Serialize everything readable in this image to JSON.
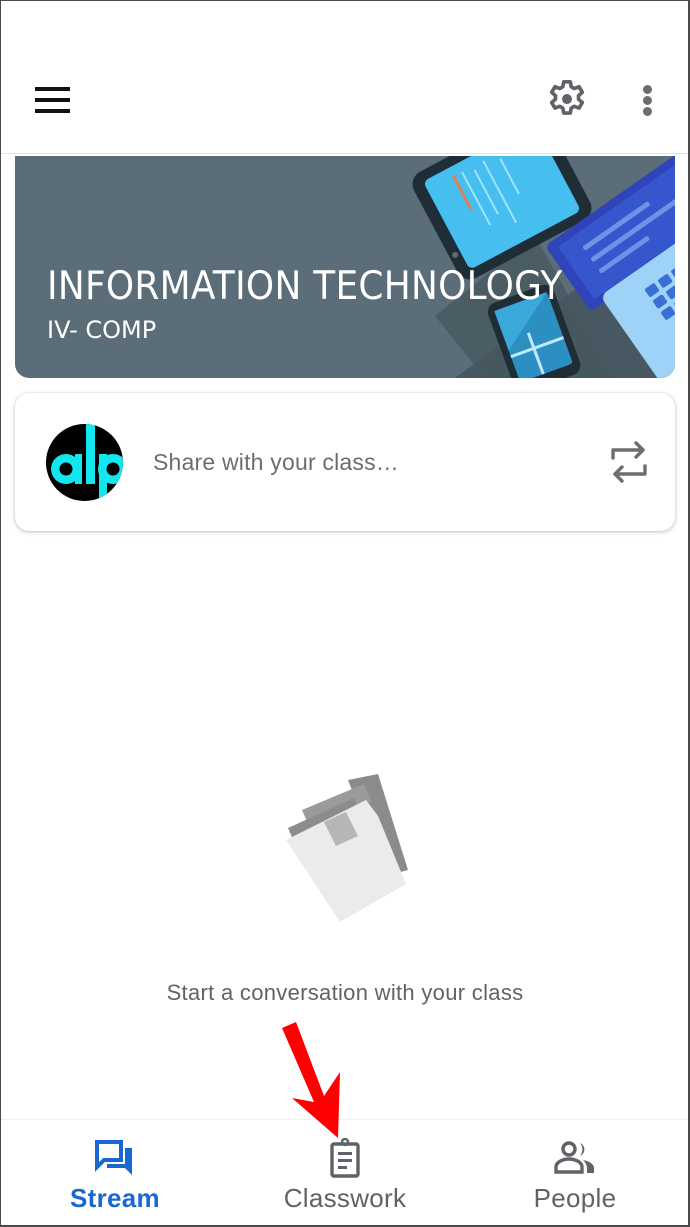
{
  "app_bar": {
    "menu_icon": "hamburger-menu-icon",
    "settings_icon": "gear-icon",
    "more_icon": "more-vertical-icon"
  },
  "banner": {
    "title": "INFORMATION TECHNOLOGY",
    "subtitle": "IV- COMP",
    "background_color": "#5a6d78"
  },
  "share_card": {
    "avatar_text": "alp",
    "avatar_colors": {
      "background": "#000000",
      "text": "#14e6f0"
    },
    "placeholder": "Share with your class…",
    "repost_icon": "repost-icon"
  },
  "empty_state": {
    "illustration": "documents-illustration",
    "message": "Start a conversation with your class"
  },
  "annotation": {
    "type": "red-arrow",
    "points_to": "Classwork",
    "color": "#ff0000"
  },
  "bottom_nav": {
    "items": [
      {
        "label": "Stream",
        "icon": "stream-chat-icon",
        "active": true
      },
      {
        "label": "Classwork",
        "icon": "clipboard-icon",
        "active": false
      },
      {
        "label": "People",
        "icon": "people-icon",
        "active": false
      }
    ],
    "active_color": "#1a67d2",
    "inactive_color": "#5f6368"
  }
}
